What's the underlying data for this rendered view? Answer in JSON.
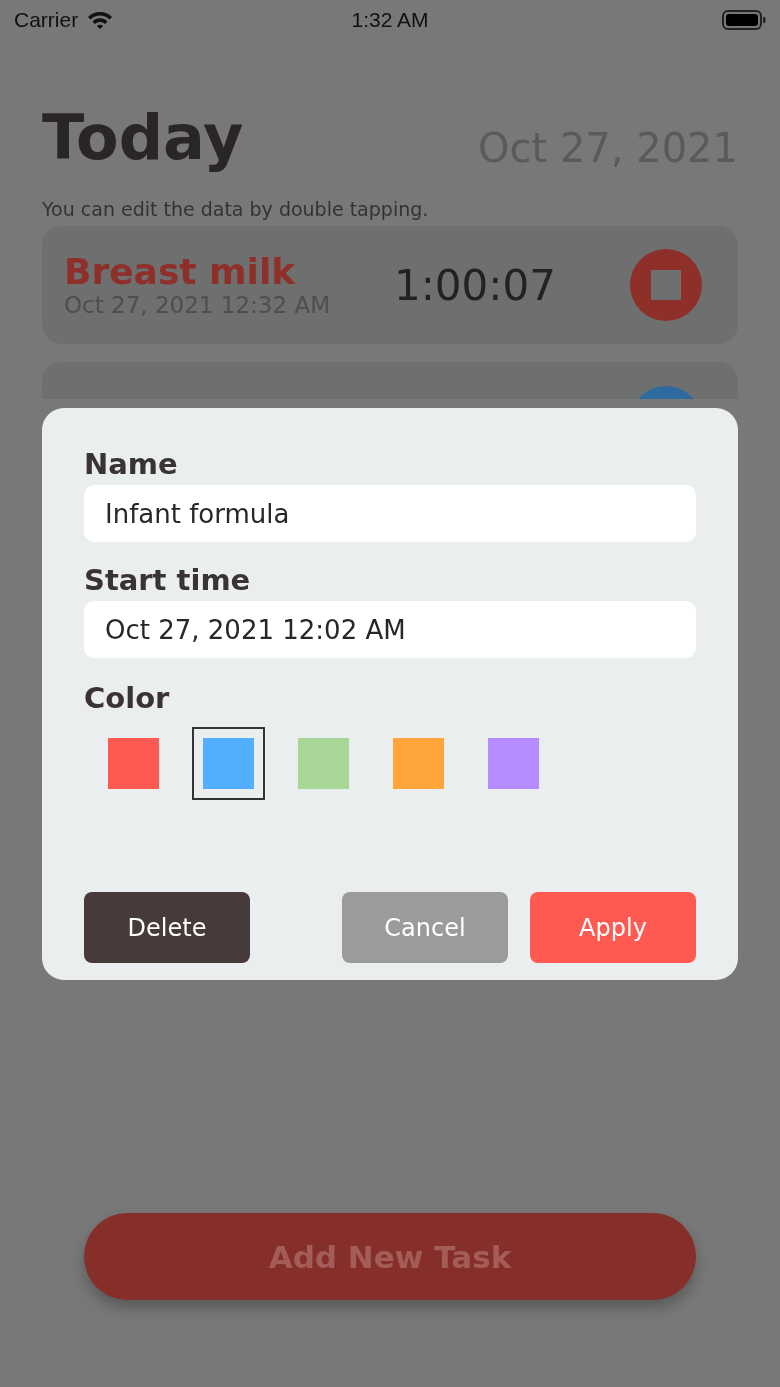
{
  "status_bar": {
    "carrier": "Carrier",
    "time": "1:32 AM"
  },
  "header": {
    "title": "Today",
    "date": "Oct 27, 2021",
    "hint": "You can edit the data by double tapping."
  },
  "tasks": [
    {
      "name": "Breast milk",
      "started": "Oct 27, 2021 12:32 AM",
      "elapsed": "1:00:07",
      "color": "#8f2f2a",
      "running": true
    },
    {
      "color": "#2d6aa0"
    }
  ],
  "dialog": {
    "fields": [
      {
        "label": "Name",
        "value": "Infant formula"
      },
      {
        "label": "Start time",
        "value": "Oct 27, 2021 12:02 AM"
      }
    ],
    "color_label": "Color",
    "swatches": [
      {
        "color": "#ff5a52",
        "selected": false
      },
      {
        "color": "#52aeff",
        "selected": true
      },
      {
        "color": "#a8d797",
        "selected": false
      },
      {
        "color": "#ffa53a",
        "selected": false
      },
      {
        "color": "#b48cff",
        "selected": false
      }
    ],
    "buttons": [
      {
        "label": "Delete",
        "kind": "delete"
      },
      {
        "label": "Cancel",
        "kind": "cancel"
      },
      {
        "label": "Apply",
        "kind": "apply"
      }
    ]
  },
  "add_button": "Add New Task"
}
